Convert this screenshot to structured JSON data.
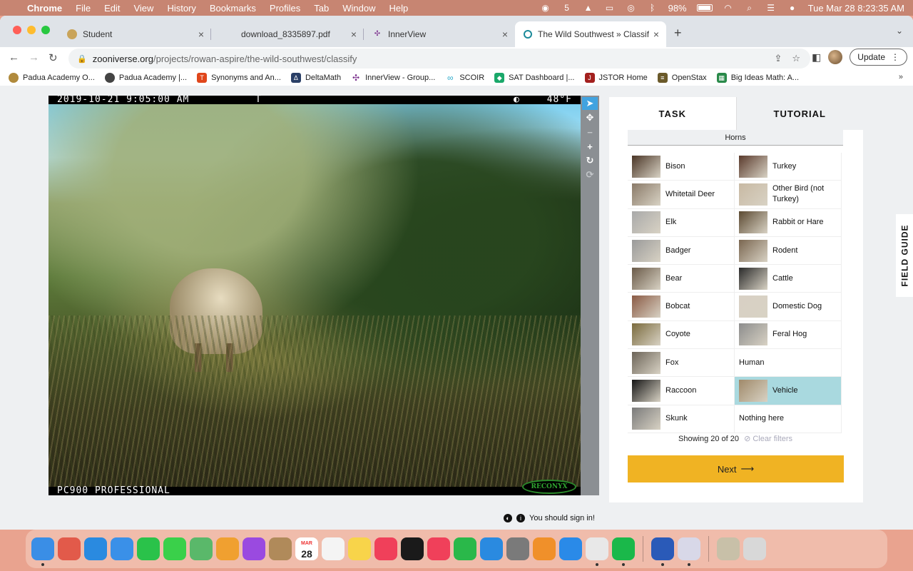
{
  "menubar": {
    "app": "Chrome",
    "items": [
      "File",
      "Edit",
      "View",
      "History",
      "Bookmarks",
      "Profiles",
      "Tab",
      "Window",
      "Help"
    ],
    "battery": "98%",
    "clock": "Tue Mar 28  8:23:35 AM"
  },
  "tabs": [
    {
      "title": "Student"
    },
    {
      "title": "download_8335897.pdf"
    },
    {
      "title": "InnerView"
    },
    {
      "title": "The Wild Southwest » Classify"
    }
  ],
  "address": {
    "domain": "zooniverse.org",
    "path": "/projects/rowan-aspire/the-wild-southwest/classify"
  },
  "update_label": "Update",
  "bookmarks": [
    {
      "label": "Padua Academy O...",
      "color": "#b08a3c"
    },
    {
      "label": "Padua Academy |...",
      "color": "#444444"
    },
    {
      "label": "Synonyms and An...",
      "color": "#e0461b"
    },
    {
      "label": "DeltaMath",
      "color": "#2a3f66"
    },
    {
      "label": "InnerView - Group...",
      "color": "#7a2f8c"
    },
    {
      "label": "SCOIR",
      "color": "#2aa9c9"
    },
    {
      "label": "SAT Dashboard |...",
      "color": "#1aa86a"
    },
    {
      "label": "JSTOR Home",
      "color": "#a3201e"
    },
    {
      "label": "OpenStax",
      "color": "#6b5a2a"
    },
    {
      "label": "Big Ideas Math: A...",
      "color": "#2a8a4a"
    }
  ],
  "camera": {
    "timestamp": "2019-10-21 9:05:00 AM",
    "flag": "T",
    "temperature": "48°F",
    "model": "PC900 PROFESSIONAL",
    "brand": "RECONYX"
  },
  "signin_text": "You should sign in!",
  "panel": {
    "tab_task": "TASK",
    "tab_tutorial": "TUTORIAL",
    "filter_label": "Horns",
    "choices": [
      {
        "label": "Bison",
        "thumb": "#4a3526",
        "selected": false
      },
      {
        "label": "Turkey",
        "thumb": "#5a3a2c",
        "selected": false
      },
      {
        "label": "Whitetail Deer",
        "thumb": "#8a7a68",
        "selected": false
      },
      {
        "label": "Other Bird (not Turkey)",
        "thumb": "#c8b9a3",
        "selected": false
      },
      {
        "label": "Elk",
        "thumb": "#a9a9a9",
        "selected": false
      },
      {
        "label": "Rabbit or Hare",
        "thumb": "#5c4a32",
        "selected": false
      },
      {
        "label": "Badger",
        "thumb": "#9a9a9a",
        "selected": false
      },
      {
        "label": "Rodent",
        "thumb": "#7a6650",
        "selected": false
      },
      {
        "label": "Bear",
        "thumb": "#6a5a48",
        "selected": false
      },
      {
        "label": "Cattle",
        "thumb": "#2a2a2a",
        "selected": false
      },
      {
        "label": "Bobcat",
        "thumb": "#8a5a44",
        "selected": false
      },
      {
        "label": "Domestic Dog",
        "thumb": "#d8d0c4",
        "selected": false
      },
      {
        "label": "Coyote",
        "thumb": "#7a6a3c",
        "selected": false
      },
      {
        "label": "Feral Hog",
        "thumb": "#8c8c8c",
        "selected": false
      },
      {
        "label": "Fox",
        "thumb": "#6c6458",
        "selected": false
      },
      {
        "label": "Human",
        "thumb": "",
        "selected": false
      },
      {
        "label": "Raccoon",
        "thumb": "#151515",
        "selected": false
      },
      {
        "label": "Vehicle",
        "thumb": "#a08a6a",
        "selected": true
      },
      {
        "label": "Skunk",
        "thumb": "#7a7a7a",
        "selected": false
      },
      {
        "label": "Nothing here",
        "thumb": "",
        "selected": false
      }
    ],
    "showing": "Showing 20 of 20",
    "clear_filters": "Clear filters",
    "next_label": "Next",
    "field_guide": "FIELD GUIDE"
  },
  "dock": {
    "calendar_month": "MAR",
    "calendar_day": "28",
    "apps": [
      {
        "name": "finder-icon",
        "color": "#3a8ee6"
      },
      {
        "name": "launchpad-icon",
        "color": "#e25a4a"
      },
      {
        "name": "safari-icon",
        "color": "#2a8ae0"
      },
      {
        "name": "mail-icon",
        "color": "#3a90e8"
      },
      {
        "name": "facetime-icon",
        "color": "#2ac24a"
      },
      {
        "name": "messages-icon",
        "color": "#3ad04a"
      },
      {
        "name": "maps-icon",
        "color": "#5ab86a"
      },
      {
        "name": "photos-icon",
        "color": "#f0a030"
      },
      {
        "name": "podcasts-icon",
        "color": "#9a4ae0"
      },
      {
        "name": "contacts-icon",
        "color": "#b08a5a"
      },
      {
        "name": "calendar-icon",
        "color": "#ffffff"
      },
      {
        "name": "reminders-icon",
        "color": "#f4f4f4"
      },
      {
        "name": "notes-icon",
        "color": "#f8d44a"
      },
      {
        "name": "music-icon",
        "color": "#f0405a"
      },
      {
        "name": "tv-icon",
        "color": "#1a1a1a"
      },
      {
        "name": "news-icon",
        "color": "#f0405a"
      },
      {
        "name": "numbers-icon",
        "color": "#2ab84a"
      },
      {
        "name": "keynote-icon",
        "color": "#2a8ae0"
      },
      {
        "name": "system-preferences-icon",
        "color": "#7a7a7a"
      },
      {
        "name": "pages-icon",
        "color": "#f0902a"
      },
      {
        "name": "app-store-icon",
        "color": "#2a8ae8"
      },
      {
        "name": "chrome-icon",
        "color": "#e8e8e8"
      },
      {
        "name": "spotify-icon",
        "color": "#1ab84a"
      },
      {
        "name": "word-icon",
        "color": "#2a5ab8"
      },
      {
        "name": "preview-icon",
        "color": "#d8d8e8"
      },
      {
        "name": "document-icon",
        "color": "#c8c0a8"
      },
      {
        "name": "trash-icon",
        "color": "#d8d8d8"
      }
    ]
  }
}
